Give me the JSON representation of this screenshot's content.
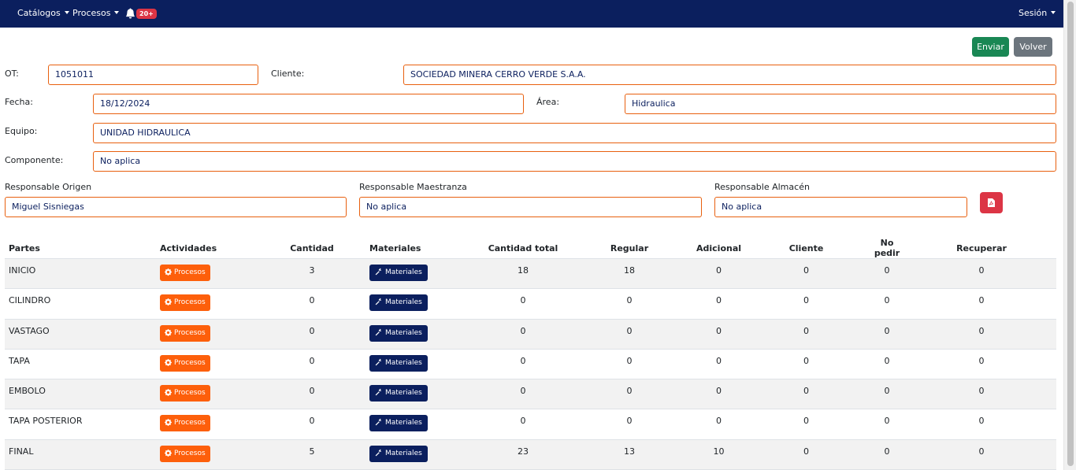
{
  "navbar": {
    "catalogos_label": "Catálogos",
    "procesos_label": "Procesos",
    "notifications_badge": "20+",
    "sesion_label": "Sesión"
  },
  "actions": {
    "enviar_label": "Enviar",
    "volver_label": "Volver"
  },
  "form": {
    "ot": {
      "label": "OT:",
      "value": "1051011"
    },
    "cliente": {
      "label": "Cliente:",
      "value": "SOCIEDAD MINERA CERRO VERDE S.A.A."
    },
    "fecha": {
      "label": "Fecha:",
      "value": "18/12/2024"
    },
    "area": {
      "label": "Área:",
      "value": "Hidraulica"
    },
    "equipo": {
      "label": "Equipo:",
      "value": "UNIDAD HIDRAULICA"
    },
    "componente": {
      "label": "Componente:",
      "value": "No aplica"
    },
    "resp_origen": {
      "label": "Responsable Origen",
      "value": "Miguel Sisniegas"
    },
    "resp_maestranza": {
      "label": "Responsable Maestranza",
      "value": "No aplica"
    },
    "resp_almacen": {
      "label": "Responsable Almacén",
      "value": "No aplica"
    }
  },
  "table": {
    "headers": [
      "Partes",
      "Actividades",
      "Cantidad",
      "Materiales",
      "Cantidad total",
      "Regular",
      "Adicional",
      "Cliente",
      "No pedir",
      "Recuperar"
    ],
    "procesos_label": "Procesos",
    "materiales_label": "Materiales",
    "rows": [
      {
        "parte": "INICIO",
        "cantidad": "3",
        "total": "18",
        "regular": "18",
        "adicional": "0",
        "cliente": "0",
        "no_pedir": "0",
        "recuperar": "0"
      },
      {
        "parte": "CILINDRO",
        "cantidad": "0",
        "total": "0",
        "regular": "0",
        "adicional": "0",
        "cliente": "0",
        "no_pedir": "0",
        "recuperar": "0"
      },
      {
        "parte": "VASTAGO",
        "cantidad": "0",
        "total": "0",
        "regular": "0",
        "adicional": "0",
        "cliente": "0",
        "no_pedir": "0",
        "recuperar": "0"
      },
      {
        "parte": "TAPA",
        "cantidad": "0",
        "total": "0",
        "regular": "0",
        "adicional": "0",
        "cliente": "0",
        "no_pedir": "0",
        "recuperar": "0"
      },
      {
        "parte": "EMBOLO",
        "cantidad": "0",
        "total": "0",
        "regular": "0",
        "adicional": "0",
        "cliente": "0",
        "no_pedir": "0",
        "recuperar": "0"
      },
      {
        "parte": "TAPA POSTERIOR",
        "cantidad": "0",
        "total": "0",
        "regular": "0",
        "adicional": "0",
        "cliente": "0",
        "no_pedir": "0",
        "recuperar": "0"
      },
      {
        "parte": "FINAL",
        "cantidad": "5",
        "total": "23",
        "regular": "13",
        "adicional": "10",
        "cliente": "0",
        "no_pedir": "0",
        "recuperar": "0"
      }
    ]
  },
  "colors": {
    "navbar": "#0b1f5e",
    "field_border": "#e8600f",
    "procesos_button": "#fd5f0b",
    "materiales_button": "#0b1f5e",
    "enviar_button": "#198754",
    "volver_button": "#6c757d",
    "pdf_button": "#dc3545"
  },
  "icons": {
    "notifications": "bell-icon",
    "pdf": "file-pdf-icon",
    "procesos": "gear-icon",
    "materiales": "hammer-icon"
  }
}
